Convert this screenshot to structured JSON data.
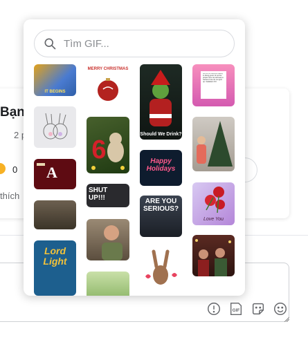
{
  "background": {
    "post_title": "Bạn",
    "post_time": "2 p",
    "reaction_count": "0",
    "like_label": "thích",
    "reaction_emoji_color": "#f7b125"
  },
  "gif_picker": {
    "search": {
      "placeholder": "Tìm GIF...",
      "value": "",
      "icon": "search-icon"
    },
    "gifs": [
      {
        "caption": "IT BEGINS"
      },
      {
        "caption": "MERRY CHRISTMAS"
      },
      {
        "caption": "Should We Drink?"
      },
      {
        "caption": "Let us not become weary in doing good, for at the proper time we will reap a harvest if we do not give up. Galatians 6:9"
      },
      {
        "caption": ""
      },
      {
        "caption": "6"
      },
      {
        "caption": ""
      },
      {
        "caption": ""
      },
      {
        "caption": "Happy Holidays"
      },
      {
        "caption": "SHUT UP!!!"
      },
      {
        "caption": ""
      },
      {
        "caption": "Love You"
      },
      {
        "caption": "ARE YOU SERIOUS?"
      },
      {
        "caption": ""
      },
      {
        "caption": ""
      },
      {
        "caption": "Lord Light"
      },
      {
        "caption": ""
      },
      {
        "caption": ""
      },
      {
        "caption": ""
      }
    ]
  },
  "composer": {
    "icons": [
      "alert-circle-icon",
      "gif-icon",
      "sticker-icon",
      "emoji-icon"
    ]
  }
}
